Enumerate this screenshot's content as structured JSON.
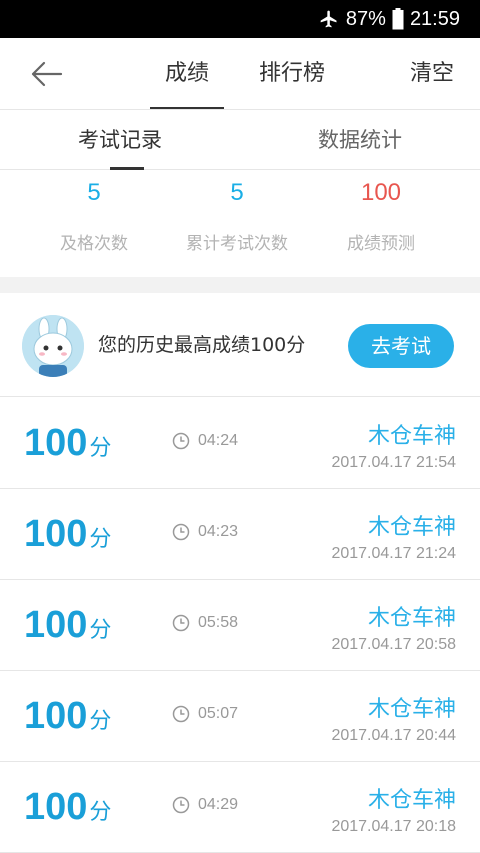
{
  "status_bar": {
    "battery": "87%",
    "time": "21:59",
    "icons": [
      "airplane-icon",
      "battery-icon"
    ]
  },
  "nav": {
    "back_icon": "back-arrow-icon",
    "tabs": [
      "成绩",
      "排行榜"
    ],
    "active_tab": 0,
    "clear_label": "清空"
  },
  "sub_tabs": {
    "items": [
      "考试记录",
      "数据统计"
    ],
    "active": 0
  },
  "stats": [
    {
      "value": "5",
      "label": "及格次数"
    },
    {
      "value": "5",
      "label": "累计考试次数"
    },
    {
      "value": "100",
      "label": "成绩预测"
    }
  ],
  "best": {
    "text": "您的历史最高成绩100分",
    "button": "去考试"
  },
  "records": [
    {
      "score": "100",
      "unit": "分",
      "duration": "04:24",
      "name": "木仓车神",
      "datetime": "2017.04.17  21:54"
    },
    {
      "score": "100",
      "unit": "分",
      "duration": "04:23",
      "name": "木仓车神",
      "datetime": "2017.04.17  21:24"
    },
    {
      "score": "100",
      "unit": "分",
      "duration": "05:58",
      "name": "木仓车神",
      "datetime": "2017.04.17  20:58"
    },
    {
      "score": "100",
      "unit": "分",
      "duration": "05:07",
      "name": "木仓车神",
      "datetime": "2017.04.17  20:44"
    },
    {
      "score": "100",
      "unit": "分",
      "duration": "04:29",
      "name": "木仓车神",
      "datetime": "2017.04.17  20:18"
    }
  ],
  "colors": {
    "accent": "#2ab0e8",
    "score_blue": "#1a9fd8",
    "prediction_red": "#e8564f"
  }
}
